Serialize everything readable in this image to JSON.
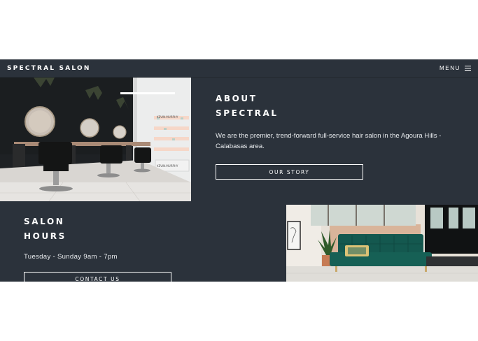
{
  "header": {
    "logo": "SPECTRAL SALON",
    "menu_label": "MENU",
    "menu_icon": "hamburger-icon"
  },
  "about": {
    "heading_line1": "ABOUT",
    "heading_line2": "SPECTRAL",
    "description": "We are the premier, trend-forward full-service hair salon in the Agoura Hills - Calabasas area.",
    "button_label": "OUR STORY"
  },
  "hours": {
    "heading_line1": "SALON",
    "heading_line2": "HOURS",
    "schedule": "Tuesday - Sunday 9am - 7pm",
    "button_label": "CONTACT US"
  },
  "photos": {
    "interior": "salon-interior-photo",
    "lounge": "salon-lounge-sofa-photo",
    "interior_wall_text": "KEVIN.MURPHY",
    "interior_wall_text_2": "KEVIN.MURPHY"
  },
  "colors": {
    "background": "#2b323b",
    "text": "#ffffff",
    "sofa": "#14584f",
    "wall": "#d9b49a"
  }
}
